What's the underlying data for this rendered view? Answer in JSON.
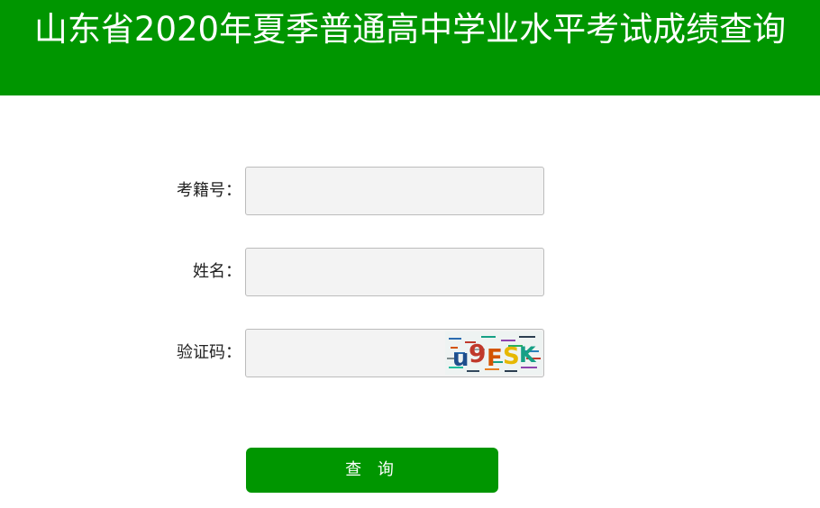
{
  "header": {
    "title": "山东省2020年夏季普通高中学业水平考试成绩查询"
  },
  "form": {
    "exam_id_label": "考籍号：",
    "name_label": "姓名：",
    "captcha_label": "验证码：",
    "exam_id_value": "",
    "name_value": "",
    "captcha_value": "",
    "captcha_text": "u9FSK"
  },
  "submit_label": "查 询",
  "colors": {
    "brand_green": "#009600",
    "input_bg": "#f3f3f3"
  }
}
